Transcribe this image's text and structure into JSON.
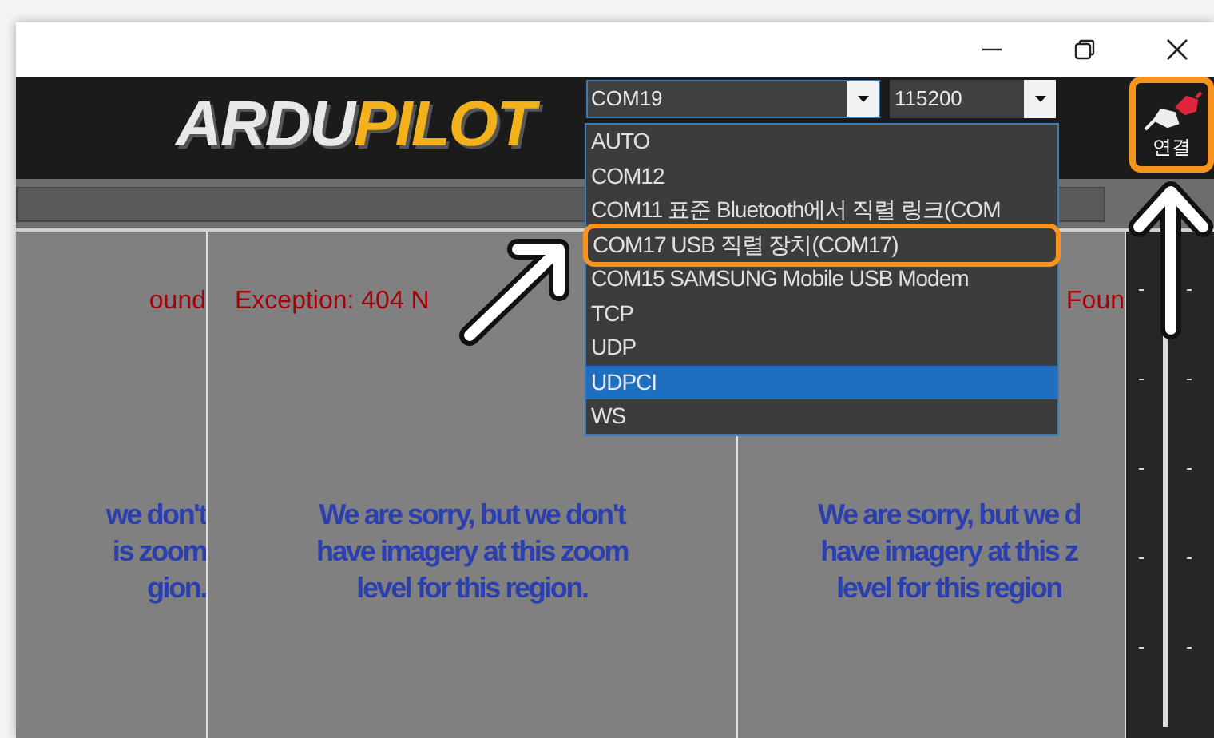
{
  "window": {
    "controls": [
      {
        "kind": "minimize"
      },
      {
        "kind": "maximize"
      },
      {
        "kind": "close"
      }
    ]
  },
  "logo": {
    "first": "ARDU",
    "second": "PILOT"
  },
  "port_select": {
    "value": "COM19",
    "expanded": true
  },
  "baud_select": {
    "value": "115200"
  },
  "connect_button": {
    "label": "연결",
    "highlighted": true
  },
  "port_options": [
    {
      "label": "AUTO",
      "selected": false,
      "highlighted": false
    },
    {
      "label": "COM12",
      "selected": false,
      "highlighted": false
    },
    {
      "label": "COM11 표준 Bluetooth에서 직렬 링크(COM",
      "selected": false,
      "highlighted": false
    },
    {
      "label": "COM17 USB 직렬 장치(COM17)",
      "selected": false,
      "highlighted": true
    },
    {
      "label": "COM15 SAMSUNG Mobile USB Modem",
      "selected": false,
      "highlighted": false
    },
    {
      "label": "TCP",
      "selected": false,
      "highlighted": false
    },
    {
      "label": "UDP",
      "selected": false,
      "highlighted": false
    },
    {
      "label": "UDPCI",
      "selected": true,
      "highlighted": false
    },
    {
      "label": "WS",
      "selected": false,
      "highlighted": false
    }
  ],
  "map_tiles": [
    {
      "error": "ound",
      "message": [
        "we don't",
        "is zoom",
        "gion."
      ]
    },
    {
      "error": "Exception: 404 N",
      "message": [
        "We are sorry, but we don't",
        "have imagery at this zoom",
        "level for this region."
      ]
    },
    {
      "error": "Foun",
      "message": [
        "We are sorry, but we d",
        "have imagery at this z",
        "level for this region"
      ]
    }
  ]
}
